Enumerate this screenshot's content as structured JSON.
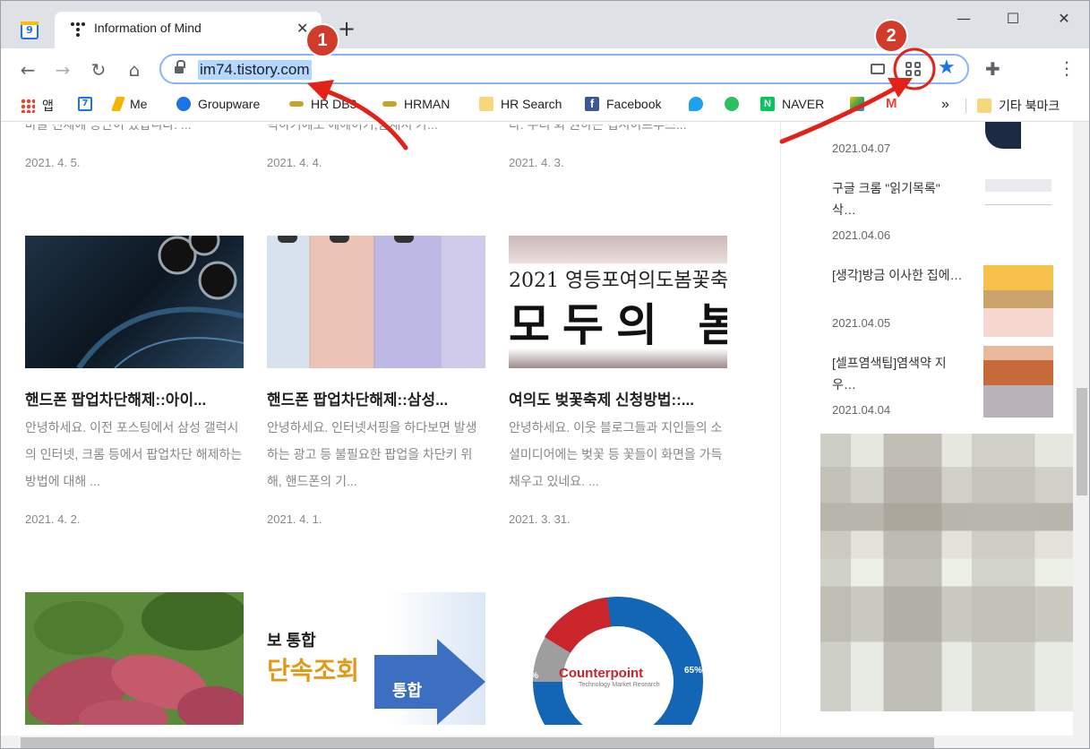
{
  "browser": {
    "pinned_tab_day": "9",
    "active_tab_title": "Information of Mind",
    "new_tab_icon": "plus-icon",
    "url": "im74.tistory.com"
  },
  "bookmarks": [
    {
      "label": "앱",
      "icon": "apps-icon",
      "color": "#ea4335"
    },
    {
      "label": "",
      "icon": "calendar-icon",
      "color": "#1a73e8",
      "day": "7"
    },
    {
      "label": "Me",
      "icon": "pen-icon",
      "color": "#f4b400"
    },
    {
      "label": "Groupware",
      "icon": "groupware-icon",
      "color": "#1a73e8"
    },
    {
      "label": "HR DB3",
      "icon": "key-icon",
      "color": "#c9a227"
    },
    {
      "label": "HRMAN",
      "icon": "key-icon",
      "color": "#c9a227"
    },
    {
      "label": "HR Search",
      "icon": "folder-icon",
      "color": "#f7d67c"
    },
    {
      "label": "Facebook",
      "icon": "facebook-icon",
      "color": "#3b5998"
    },
    {
      "label": "",
      "icon": "twitter-icon",
      "color": "#1da1f2"
    },
    {
      "label": "",
      "icon": "evernote-icon",
      "color": "#2dbe60"
    },
    {
      "label": "NAVER",
      "icon": "naver-icon",
      "color": "#03c75a"
    },
    {
      "label": "»",
      "icon": "more-icon",
      "color": "#5f6368"
    },
    {
      "label": "기타 북마크",
      "icon": "folder-icon",
      "color": "#f7d67c"
    }
  ],
  "posts_top_row": [
    {
      "excerpt": "마글 전체에 공단이 있답니다. ...",
      "date": "2021. 4. 5."
    },
    {
      "excerpt": "럭하기에도 에헤이기,탐새서 가...",
      "date": "2021. 4. 4."
    },
    {
      "excerpt": "다. 우리 회 원하는 컵시이프부스...",
      "date": "2021. 4. 3."
    }
  ],
  "posts": [
    {
      "title": "핸드폰 팝업차단해제::아이...",
      "desc": "안녕하세요.  이전 포스팅에서 삼성 갤럭시의 인터넷, 크롬 등에서 팝업차단 해제하는 방법에 대해 ...",
      "date": "2021. 4. 2.",
      "thumb": "iphone-image"
    },
    {
      "title": "핸드폰 팝업차단해제::삼성...",
      "desc": "안녕하세요.  인터넷서핑을 하다보면 발생하는 광고 등 불필요한 팝업을 차단키 위해,  핸드폰의 기...",
      "date": "2021. 4. 1.",
      "thumb": "galaxy-image"
    },
    {
      "title": "여의도 벚꽃축제 신청방법::...",
      "desc": "안녕하세요. 이웃 블로그들과 지인들의 소셜미디어에는 벚꽃 등 꽃들이 화면을 가득채우고 있네요.  ...",
      "date": "2021. 3. 31.",
      "thumb": "cherry-blossom-image",
      "thumb_text_top": "2021 영등포여의도봄꽃축제",
      "thumb_text_main": "모두의 봄"
    }
  ],
  "posts_bottom_row": [
    {
      "thumb": "sweet-potato-image"
    },
    {
      "thumb": "integration-graphic",
      "text_1": "보 통합",
      "text_2": "단속조회",
      "text_3": "통합"
    },
    {
      "thumb": "counterpoint-donut",
      "brand": "Counterpoint",
      "sub": "Technology Market Research",
      "pct_a": "13%",
      "pct_b": "20%",
      "pct_c": "65%"
    }
  ],
  "sidebar": [
    {
      "title": "",
      "date": "2021.04.07"
    },
    {
      "title": "구글 크롬 \"읽기목록\" 삭…",
      "date": "2021.04.06"
    },
    {
      "title": "[생각]방금 이사한 집에…",
      "date": "2021.04.05"
    },
    {
      "title": "[셀프염색팁]염색약 지우…",
      "date": "2021.04.04"
    }
  ],
  "annotations": [
    {
      "number": "1",
      "color": "#d23b2a"
    },
    {
      "number": "2",
      "color": "#d23b2a"
    }
  ]
}
